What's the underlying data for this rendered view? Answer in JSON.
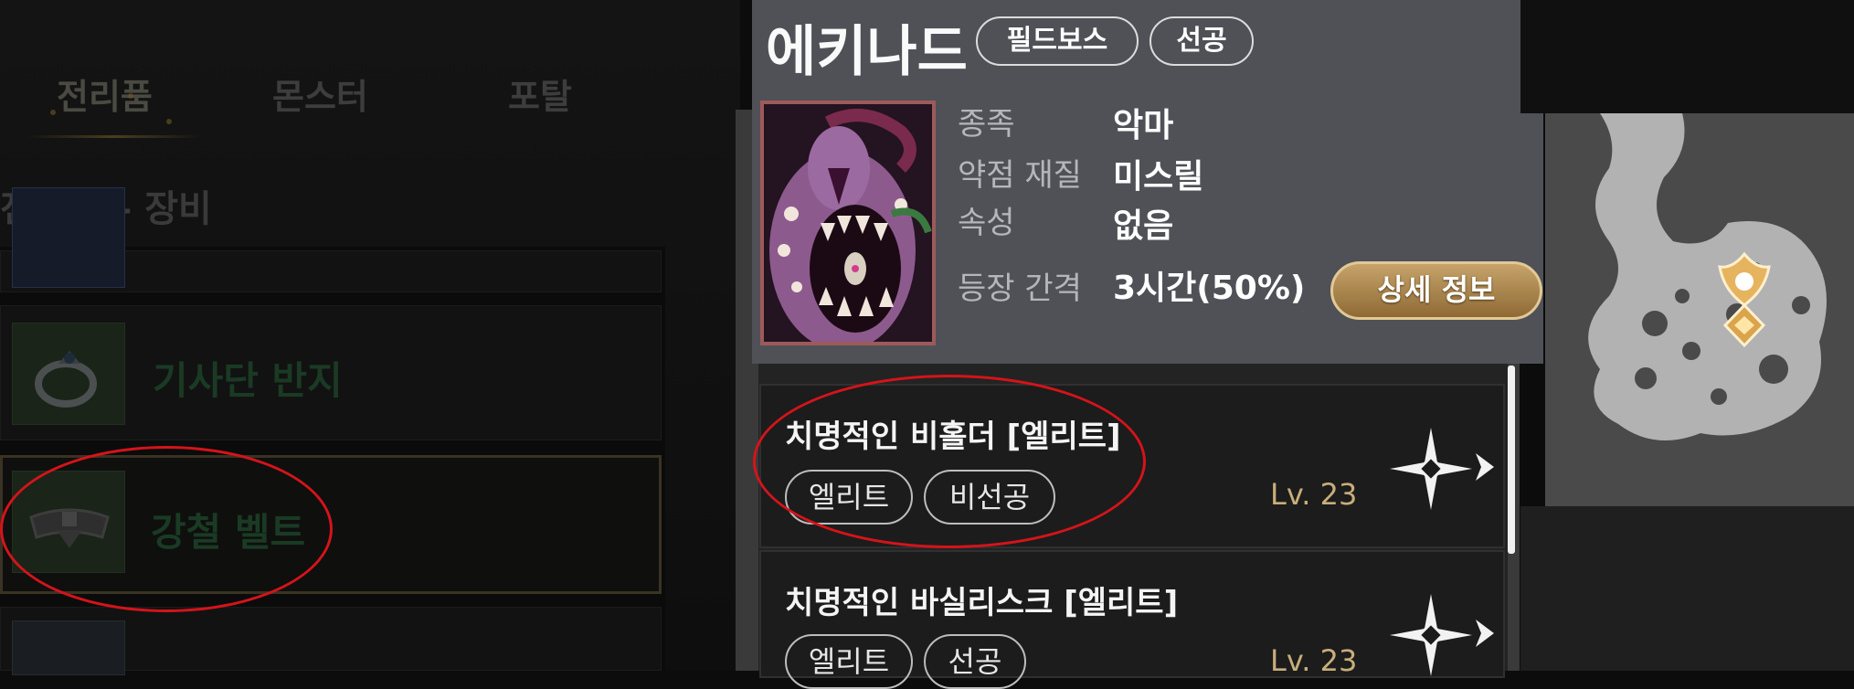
{
  "left_panel": {
    "tabs": [
      {
        "label": "전리품"
      },
      {
        "label": "몬스터"
      },
      {
        "label": "포탈"
      }
    ],
    "section_title": "전리품 – 장비",
    "items": [
      {
        "name": "기사단 반지"
      },
      {
        "name": "강철 벨트"
      }
    ]
  },
  "boss": {
    "name": "에키나드",
    "tags": [
      "필드보스",
      "선공"
    ],
    "info": [
      {
        "label": "종족",
        "value": "악마"
      },
      {
        "label": "약점 재질",
        "value": "미스릴"
      },
      {
        "label": "속성",
        "value": "없음"
      },
      {
        "label": "등장 간격",
        "value": "3시간(50%)"
      }
    ],
    "detail_button": "상세 정보"
  },
  "monsters": [
    {
      "name": "치명적인 비홀더 [엘리트]",
      "tags": [
        "엘리트",
        "비선공"
      ],
      "level": "Lv. 23"
    },
    {
      "name": "치명적인 바실리스크 [엘리트]",
      "tags": [
        "엘리트",
        "선공"
      ],
      "level": "Lv. 23"
    }
  ],
  "colors": {
    "accent_gold": "#c8ae7a",
    "annotation_red": "#d4141a",
    "header_card": "#4f5157"
  },
  "icons": {
    "compass": "compass-star-icon",
    "arrow": "arrow-right-icon",
    "boss_marker": "boss-marker-icon"
  }
}
